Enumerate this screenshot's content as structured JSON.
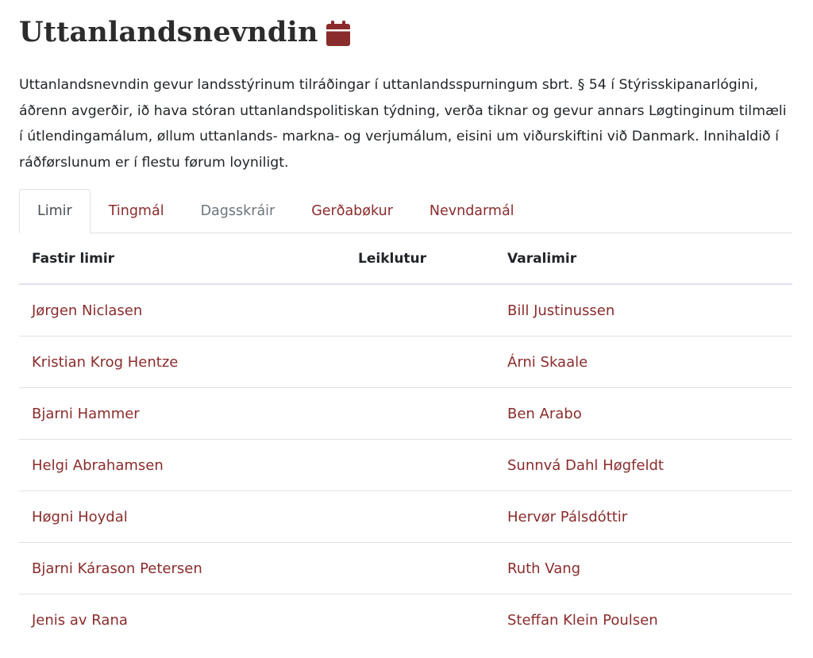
{
  "header": {
    "title": "Uttanlandsnevndin",
    "icon": "calendar-icon",
    "icon_color": "#8b2c2c"
  },
  "description": "Uttanlandsnevndin gevur landsstýrinum tilráðingar í uttanlandsspurningum sbrt. § 54 í Stýrisskipanarlógini, áðrenn avgerðir, ið hava stóran uttanlandspolitiskan týdning, verða tiknar og gevur annars Løgtinginum tilmæli í útlendingamálum, øllum uttanlands- markna- og verjumálum, eisini um viðurskiftini við Danmark. Innihaldið í ráðførslunum er í flestu førum loyniligt.",
  "tabs": [
    {
      "label": "Limir",
      "state": "active"
    },
    {
      "label": "Tingmál",
      "state": "link"
    },
    {
      "label": "Dagsskráir",
      "state": "muted"
    },
    {
      "label": "Gerðabøkur",
      "state": "link"
    },
    {
      "label": "Nevndarmál",
      "state": "link"
    }
  ],
  "table": {
    "headers": {
      "member": "Fastir limir",
      "role": "Leiklutur",
      "alternate": "Varalimir"
    },
    "rows": [
      {
        "member": "Jørgen Niclasen",
        "role": "",
        "alternate": "Bill Justinussen"
      },
      {
        "member": "Kristian Krog Hentze",
        "role": "",
        "alternate": "Árni Skaale"
      },
      {
        "member": "Bjarni Hammer",
        "role": "",
        "alternate": "Ben Arabo"
      },
      {
        "member": "Helgi Abrahamsen",
        "role": "",
        "alternate": "Sunnvá Dahl Høgfeldt"
      },
      {
        "member": "Høgni Hoydal",
        "role": "",
        "alternate": "Hervør Pálsdóttir"
      },
      {
        "member": "Bjarni Kárason Petersen",
        "role": "",
        "alternate": "Ruth Vang"
      },
      {
        "member": "Jenis av Rana",
        "role": "",
        "alternate": "Steffan Klein Poulsen"
      }
    ]
  },
  "colors": {
    "accent": "#8b2c2c",
    "text": "#212529",
    "muted": "#6c757d",
    "border": "#dee2e6"
  }
}
